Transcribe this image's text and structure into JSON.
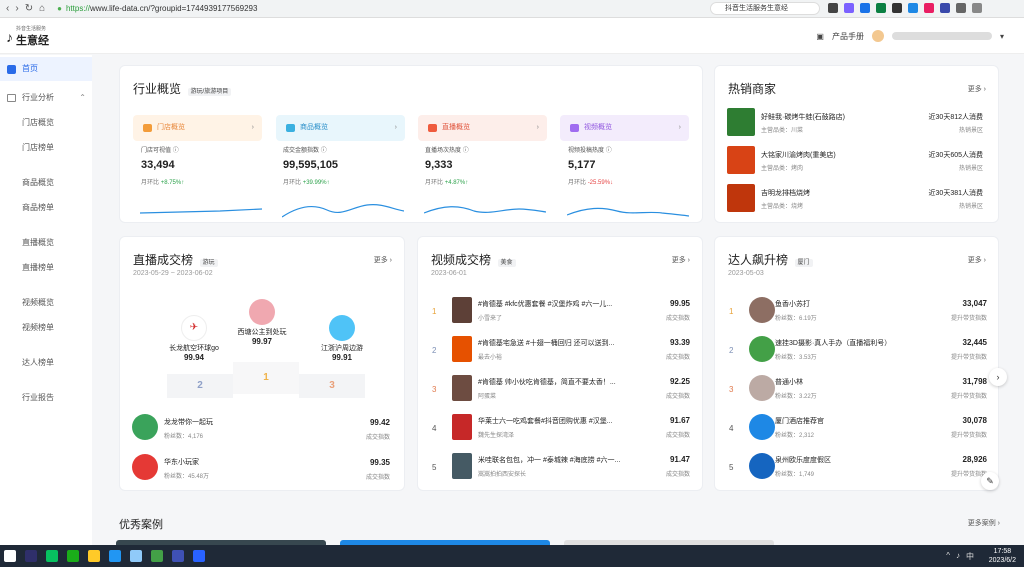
{
  "browser": {
    "url_proto": "https://",
    "url_rest": "www.life-data.cn/?groupid=1744939177569293",
    "search_text": "抖音生活服务生意经"
  },
  "header": {
    "logo_small": "抖音生活服务",
    "logo_big": "生意经",
    "manual_label": "产品手册"
  },
  "sidebar": {
    "home": "首页",
    "group": "行业分析",
    "items": [
      "门店概览",
      "门店榜单",
      "商品概览",
      "商品榜单",
      "直播概览",
      "直播榜单",
      "视频概览",
      "视频榜单",
      "达人榜单",
      "行业报告"
    ]
  },
  "overview": {
    "title": "行业概览",
    "tag": "游玩/旅游项目",
    "tiles": [
      "门店概览",
      "商品概览",
      "直播概览",
      "视频概览"
    ],
    "metrics": [
      {
        "label": "门店可视值",
        "value": "33,494",
        "change_label": "月环比",
        "change": "+8.75%",
        "dir": "up"
      },
      {
        "label": "成交金额指数",
        "value": "99,595,105",
        "change_label": "月环比",
        "change": "+39.99%",
        "dir": "up"
      },
      {
        "label": "直播场次热度",
        "value": "9,333",
        "change_label": "月环比",
        "change": "+4.87%",
        "dir": "up"
      },
      {
        "label": "视频投稿热度",
        "value": "5,177",
        "change_label": "月环比",
        "change": "-25.59%",
        "dir": "down"
      }
    ]
  },
  "hot_merchants": {
    "title": "热销商家",
    "more": "更多",
    "rows": [
      {
        "name": "好鲑我·碳烤牛蛙(石鼓路店)",
        "sub": "主营品类：川菜",
        "value": "近30天812人消费",
        "vsub": "热销景区",
        "color": "#2e7d32"
      },
      {
        "name": "大铭家川渝烤肉(重美店)",
        "sub": "主营品类：烤肉",
        "value": "近30天605人消费",
        "vsub": "热销景区",
        "color": "#d84315"
      },
      {
        "name": "吉明龙排档烧烤",
        "sub": "主营品类：烧烤",
        "value": "近30天381人消费",
        "vsub": "热销景区",
        "color": "#bf360c"
      }
    ]
  },
  "live_rank": {
    "title": "直播成交榜",
    "tag": "游玩",
    "more": "更多",
    "date": "2023-05-29 ~ 2023-06-02",
    "top3": [
      {
        "name": "西塘公主到处玩",
        "value": "99.97",
        "rank": "1"
      },
      {
        "name": "长龙航空环球go",
        "value": "99.94",
        "rank": "2"
      },
      {
        "name": "江浙沪周边游",
        "value": "99.91",
        "rank": "3"
      }
    ],
    "rows": [
      {
        "name": "龙龙带你一起玩",
        "fans": "粉丝数：4,176",
        "value": "99.42",
        "vsub": "成交指数",
        "color": "#3aa35b"
      },
      {
        "name": "华东小玩家",
        "fans": "粉丝数：45.48万",
        "value": "99.35",
        "vsub": "成交指数",
        "color": "#e53935"
      }
    ]
  },
  "video_rank": {
    "title": "视频成交榜",
    "tag": "美食",
    "more": "更多",
    "date": "2023-06-01",
    "rows": [
      {
        "rank": "1",
        "title": "#肯德基 #kfc优惠套餐 #汉堡炸鸡 #六一儿...",
        "author": "小雪来了",
        "value": "99.95",
        "vsub": "成交指数",
        "color": "#5d4037"
      },
      {
        "rank": "2",
        "title": "#肯德基宅急送 #十翅一桶回归 还可以送到...",
        "author": "最去小裕",
        "value": "93.39",
        "vsub": "成交指数",
        "color": "#e65100"
      },
      {
        "rank": "3",
        "title": "#肯德基 帅小伙吃肯德基，简直不要太香！...",
        "author": "阿蛋菜",
        "value": "92.25",
        "vsub": "成交指数",
        "color": "#6d4c41"
      },
      {
        "rank": "4",
        "title": "华莱士六一吃鸡套餐#抖音团购优惠 #汉堡...",
        "author": "魏先生探湾泽",
        "value": "91.67",
        "vsub": "成交指数",
        "color": "#c62828"
      },
      {
        "rank": "5",
        "title": "米哇联名包包，冲一 #泰城辣 #海底捞 #六一...",
        "author": "嵩嵩拍拍西安探长",
        "value": "91.47",
        "vsub": "成交指数",
        "color": "#455a64"
      }
    ]
  },
  "talent_rank": {
    "title": "达人飙升榜",
    "tag": "厦门",
    "more": "更多",
    "date": "2023-05-03",
    "rows": [
      {
        "rank": "1",
        "name": "鱼香小苏打",
        "fans": "粉丝数：6.19万",
        "value": "33,047",
        "vsub": "提升带货指数",
        "color": "#8d6e63"
      },
      {
        "rank": "2",
        "name": "速挂3D摄影·真人手办（直播福利号）",
        "fans": "粉丝数：3.53万",
        "value": "32,445",
        "vsub": "提升带货指数",
        "color": "#43a047"
      },
      {
        "rank": "3",
        "name": "普通小林",
        "fans": "粉丝数：3.22万",
        "value": "31,798",
        "vsub": "提升带货指数",
        "color": "#bcaaa4"
      },
      {
        "rank": "4",
        "name": "厦门酒店推荐官",
        "fans": "粉丝数：2,312",
        "value": "30,078",
        "vsub": "提升带货指数",
        "color": "#1e88e5"
      },
      {
        "rank": "5",
        "name": "泉州欧乐度度假区",
        "fans": "粉丝数：1,749",
        "value": "28,926",
        "vsub": "提升带货指数",
        "color": "#1565c0"
      }
    ]
  },
  "cases": {
    "title": "优秀案例",
    "more": "更多案例"
  },
  "taskbar": {
    "time": "17:58",
    "date": "2023/6/2",
    "lang": "中"
  }
}
